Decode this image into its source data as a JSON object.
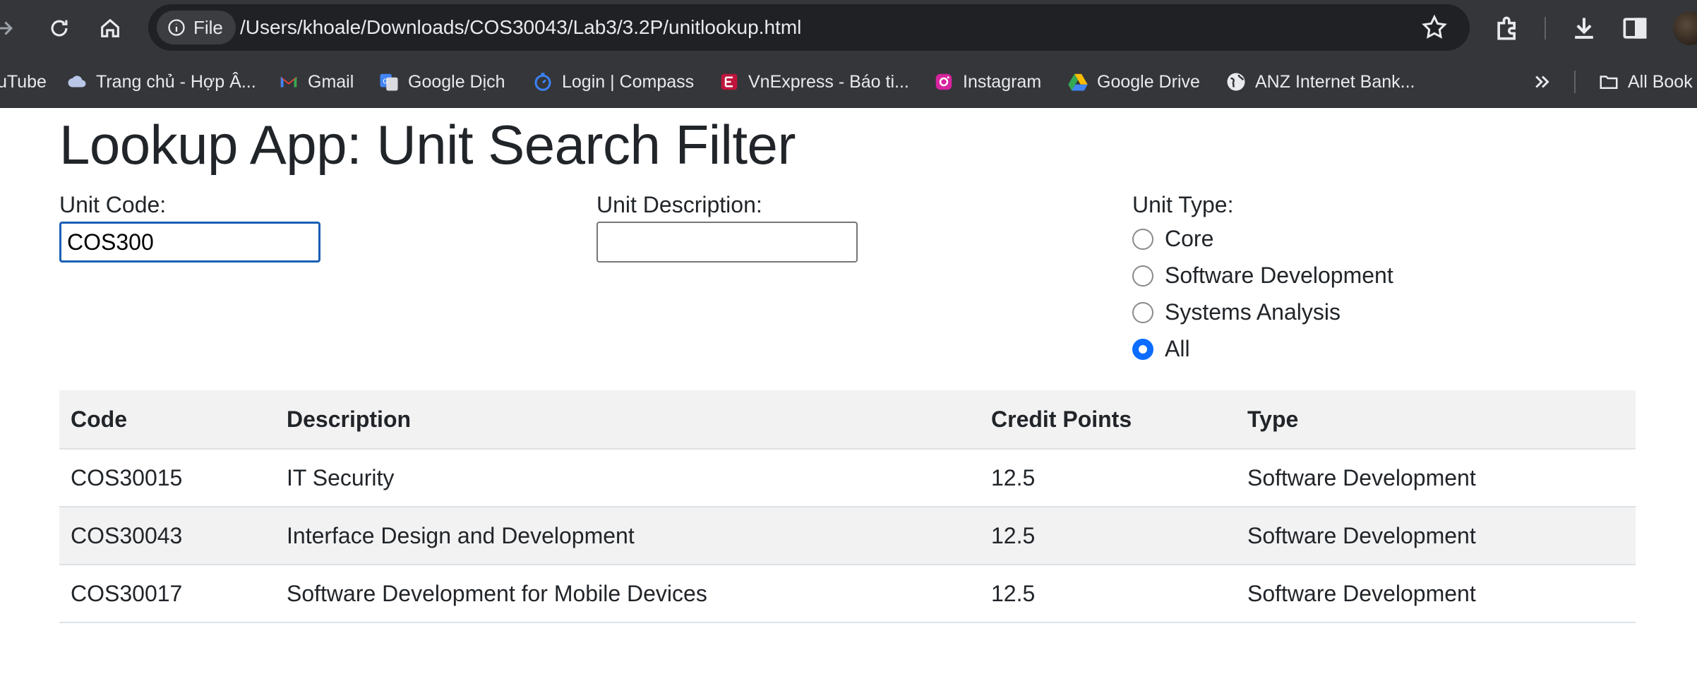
{
  "browser": {
    "address_chip": "File",
    "url": "/Users/khoale/Downloads/COS30043/Lab3/3.2P/unitlookup.html",
    "bookmarks": [
      {
        "label": "uTube",
        "icon": "youtube-icon"
      },
      {
        "label": "Trang chủ - Hợp Â...",
        "icon": "cloud-icon"
      },
      {
        "label": "Gmail",
        "icon": "gmail-icon"
      },
      {
        "label": "Google Dịch",
        "icon": "google-translate-icon"
      },
      {
        "label": "Login | Compass",
        "icon": "compass-icon"
      },
      {
        "label": "VnExpress - Báo ti...",
        "icon": "vnexpress-icon"
      },
      {
        "label": "Instagram",
        "icon": "instagram-icon"
      },
      {
        "label": "Google Drive",
        "icon": "google-drive-icon"
      },
      {
        "label": "ANZ Internet Bank...",
        "icon": "globe-icon"
      },
      {
        "label": "All Book",
        "icon": "folder-icon"
      }
    ]
  },
  "page": {
    "title": "Lookup App: Unit Search Filter",
    "unit_code": {
      "label": "Unit Code:",
      "value": "COS300"
    },
    "unit_description": {
      "label": "Unit Description:",
      "value": ""
    },
    "unit_type": {
      "label": "Unit Type:",
      "options": [
        "Core",
        "Software Development",
        "Systems Analysis",
        "All"
      ],
      "selected": "All"
    },
    "table": {
      "headers": [
        "Code",
        "Description",
        "Credit Points",
        "Type"
      ],
      "rows": [
        [
          "COS30015",
          "IT Security",
          "12.5",
          "Software Development"
        ],
        [
          "COS30043",
          "Interface Design and Development",
          "12.5",
          "Software Development"
        ],
        [
          "COS30017",
          "Software Development for Mobile Devices",
          "12.5",
          "Software Development"
        ]
      ]
    }
  },
  "colors": {
    "chrome_bg": "#35363a",
    "omnibox_bg": "#202124",
    "radio_accent": "#0b6cff",
    "focus_border": "#1a5fb4",
    "table_stripe": "#f2f2f2"
  }
}
